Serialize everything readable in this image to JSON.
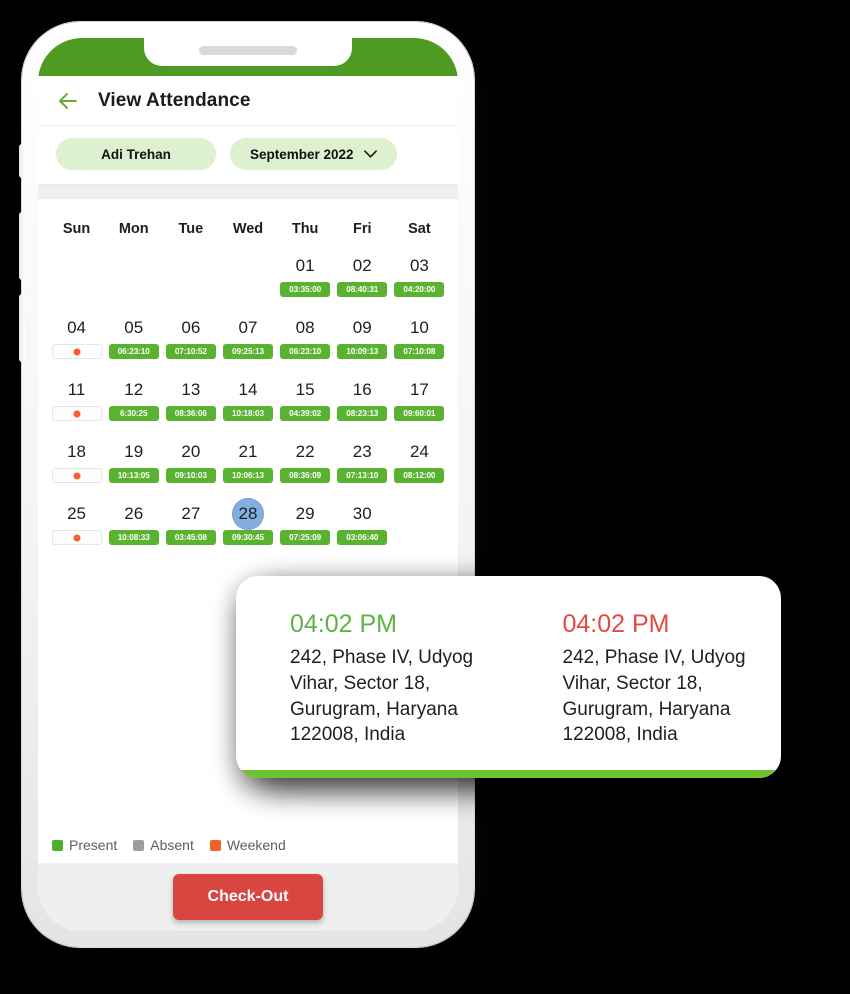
{
  "header": {
    "title": "View Attendance",
    "back_icon": "arrow-left-icon"
  },
  "filters": {
    "employee": "Adi Trehan",
    "month": "September 2022",
    "caret_icon": "chevron-down-icon"
  },
  "calendar": {
    "weekday_headers": [
      "Sun",
      "Mon",
      "Tue",
      "Wed",
      "Thu",
      "Fri",
      "Sat"
    ],
    "selected_day": "28",
    "weeks": [
      [
        {
          "day": "",
          "badge": "",
          "type": "empty"
        },
        {
          "day": "",
          "badge": "",
          "type": "empty"
        },
        {
          "day": "",
          "badge": "",
          "type": "empty"
        },
        {
          "day": "",
          "badge": "",
          "type": "empty"
        },
        {
          "day": "01",
          "badge": "03:35:00",
          "type": "present"
        },
        {
          "day": "02",
          "badge": "08:40:31",
          "type": "present"
        },
        {
          "day": "03",
          "badge": "04:20:00",
          "type": "present"
        }
      ],
      [
        {
          "day": "04",
          "badge": "",
          "type": "weekend"
        },
        {
          "day": "05",
          "badge": "06:23:10",
          "type": "present"
        },
        {
          "day": "06",
          "badge": "07:10:52",
          "type": "present"
        },
        {
          "day": "07",
          "badge": "09:25:13",
          "type": "present"
        },
        {
          "day": "08",
          "badge": "06:23:10",
          "type": "present"
        },
        {
          "day": "09",
          "badge": "10:09:13",
          "type": "present"
        },
        {
          "day": "10",
          "badge": "07:10:08",
          "type": "present"
        }
      ],
      [
        {
          "day": "11",
          "badge": "",
          "type": "weekend"
        },
        {
          "day": "12",
          "badge": "6:30:25",
          "type": "present"
        },
        {
          "day": "13",
          "badge": "08:36:06",
          "type": "present"
        },
        {
          "day": "14",
          "badge": "10:18:03",
          "type": "present"
        },
        {
          "day": "15",
          "badge": "04:39:02",
          "type": "present"
        },
        {
          "day": "16",
          "badge": "08:23:13",
          "type": "present"
        },
        {
          "day": "17",
          "badge": "09:60:01",
          "type": "present"
        }
      ],
      [
        {
          "day": "18",
          "badge": "",
          "type": "weekend"
        },
        {
          "day": "19",
          "badge": "10:13:05",
          "type": "present"
        },
        {
          "day": "20",
          "badge": "09:10:03",
          "type": "present"
        },
        {
          "day": "21",
          "badge": "10:06:13",
          "type": "present"
        },
        {
          "day": "22",
          "badge": "08:36:09",
          "type": "present"
        },
        {
          "day": "23",
          "badge": "07:13:10",
          "type": "present"
        },
        {
          "day": "24",
          "badge": "08:12:00",
          "type": "present"
        }
      ],
      [
        {
          "day": "25",
          "badge": "",
          "type": "weekend"
        },
        {
          "day": "26",
          "badge": "10:08:33",
          "type": "present"
        },
        {
          "day": "27",
          "badge": "03:45:08",
          "type": "present"
        },
        {
          "day": "28",
          "badge": "09:30:45",
          "type": "present"
        },
        {
          "day": "29",
          "badge": "07:25:09",
          "type": "present"
        },
        {
          "day": "30",
          "badge": "03:06:40",
          "type": "present"
        },
        {
          "day": "",
          "badge": "",
          "type": "empty"
        }
      ]
    ]
  },
  "legend": {
    "items": [
      {
        "label": "Present",
        "color": "#4caf2f"
      },
      {
        "label": "Absent",
        "color": "#9e9e9e"
      },
      {
        "label": "Weekend",
        "color": "#f4602c"
      }
    ]
  },
  "footer": {
    "checkout_label": "Check-Out"
  },
  "popup": {
    "check_in": {
      "time": "04:02 PM",
      "address": "242, Phase IV, Udyog Vihar, Sector 18, Gurugram, Haryana 122008, India",
      "color": "#5cb447"
    },
    "check_out": {
      "time": "04:02 PM",
      "address": "242, Phase IV, Udyog Vihar, Sector 18, Gurugram, Haryana 122008, India",
      "color": "#e24a41"
    }
  },
  "theme": {
    "brand_green": "#4f9a20",
    "badge_green": "#59b330",
    "chip_green": "#ddf0cf",
    "selected_blue": "#83aede",
    "danger_red": "#d9453f"
  }
}
